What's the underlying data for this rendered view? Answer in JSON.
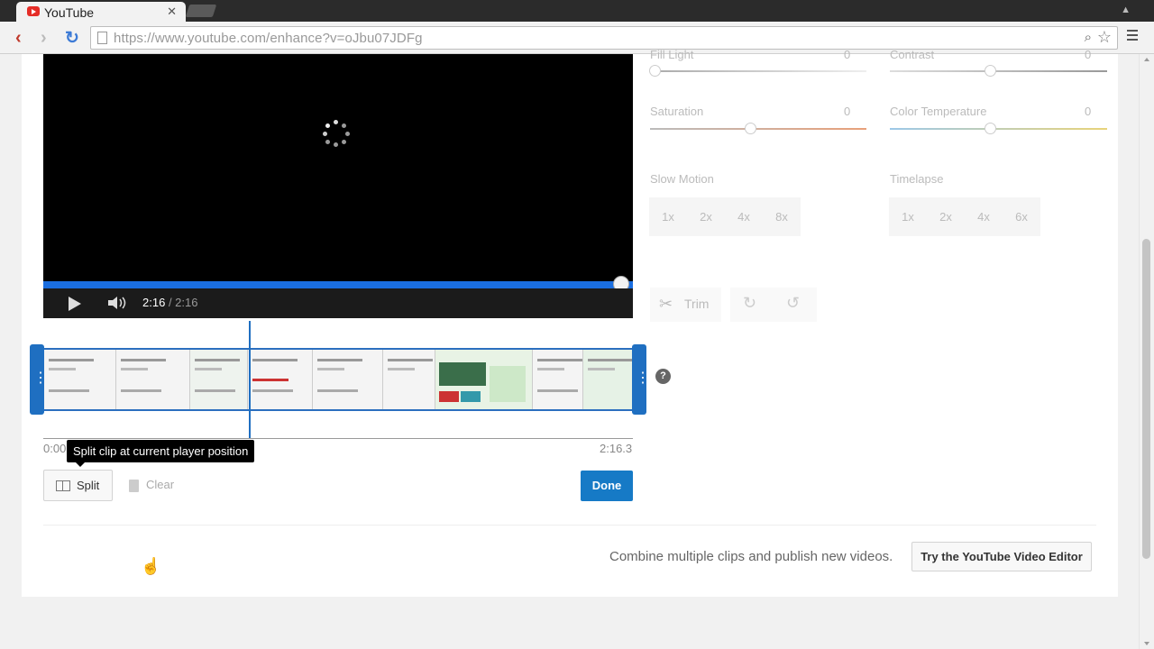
{
  "browser": {
    "tab_title": "YouTube",
    "tab_close": "✕",
    "url_host": "https://www.youtube.com",
    "url_path": "/enhance?v=oJbu07JDFg",
    "user_icon": "▲"
  },
  "player": {
    "current_time": "2:16",
    "duration": "/ 2:16",
    "progress": 1.0
  },
  "timeline": {
    "start_time": "0:00",
    "end_time": "2:16.3",
    "tooltip": "Split clip at current player position"
  },
  "actions": {
    "split_label": "Split",
    "clear_label": "Clear",
    "done_label": "Done"
  },
  "adjustments": {
    "fill_light": {
      "label": "Fill Light",
      "value": "0"
    },
    "contrast": {
      "label": "Contrast",
      "value": "0"
    },
    "saturation": {
      "label": "Saturation",
      "value": "0"
    },
    "color_temperature": {
      "label": "Color Temperature",
      "value": "0"
    },
    "slow_motion": {
      "label": "Slow Motion",
      "options": [
        "1x",
        "2x",
        "4x",
        "8x"
      ]
    },
    "timelapse": {
      "label": "Timelapse",
      "options": [
        "1x",
        "2x",
        "4x",
        "6x"
      ]
    },
    "trim_label": "Trim"
  },
  "footer": {
    "combine_text": "Combine multiple clips and publish new videos.",
    "editor_button": "Try the YouTube Video Editor"
  },
  "colors": {
    "accent": "#167ac6",
    "progress": "#1a6ee0",
    "youtube_red": "#e52d27"
  }
}
